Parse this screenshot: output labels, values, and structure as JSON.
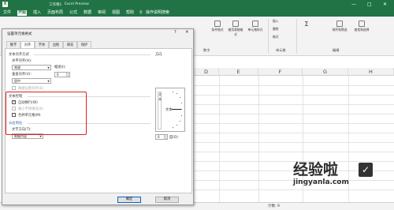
{
  "titlebar": {
    "doc_name": "工作簿1",
    "app_name": "Excel Preview",
    "controls": [
      "—",
      "□",
      "✕"
    ]
  },
  "menu": {
    "items": [
      "文件",
      "开始",
      "插入",
      "页面布局",
      "公式",
      "数据",
      "审阅",
      "视图",
      "帮助"
    ],
    "active": "开始",
    "tell_me": "操作说明搜索"
  },
  "ribbon": {
    "buttons": [
      "条件格式",
      "套用表格格式",
      "单元格样式",
      "插入",
      "删除",
      "格式",
      "排序和筛选",
      "查找和选择"
    ],
    "groups": [
      "数字",
      "单元格",
      "编辑"
    ]
  },
  "sheet": {
    "columns": [
      "D",
      "E",
      "F",
      "G",
      "H"
    ]
  },
  "statusbar": {
    "text": "计数: 9"
  },
  "dialog": {
    "title": "设置单元格格式",
    "help": "?",
    "close": "✕",
    "tabs": [
      "数字",
      "对齐",
      "字体",
      "边框",
      "填充",
      "保护"
    ],
    "active_tab": "对齐",
    "text_alignment": {
      "section": "文本对齐方式",
      "horizontal_label": "水平对齐(H):",
      "horizontal_value": "常规",
      "indent_label": "缩进(I):",
      "indent_value": "0",
      "vertical_label": "垂直对齐(V):",
      "vertical_value": "居中",
      "justify_distributed": "两端分散对齐(E)"
    },
    "text_control": {
      "section": "文本控制",
      "wrap_text": "自动换行(W)",
      "wrap_text_checked": true,
      "shrink_to_fit": "缩小字体填充(K)",
      "merge_cells": "合并单元格(M)"
    },
    "rtl": {
      "section": "从右到左",
      "direction_label": "文字方向(T):",
      "direction_value": "根据内容"
    },
    "orientation": {
      "section": "方向",
      "vertical_text": "文本",
      "text_label": "文本",
      "degrees_value": "0",
      "degrees_label": "度(D)"
    },
    "buttons": {
      "ok": "确定",
      "cancel": "取消"
    }
  },
  "watermark": {
    "text": "经验啦",
    "url": "jingyanla.com",
    "mark": "✓"
  },
  "colors": {
    "excel_green": "#217346",
    "highlight_red": "#e02020",
    "section_blue": "#2e63b5"
  }
}
